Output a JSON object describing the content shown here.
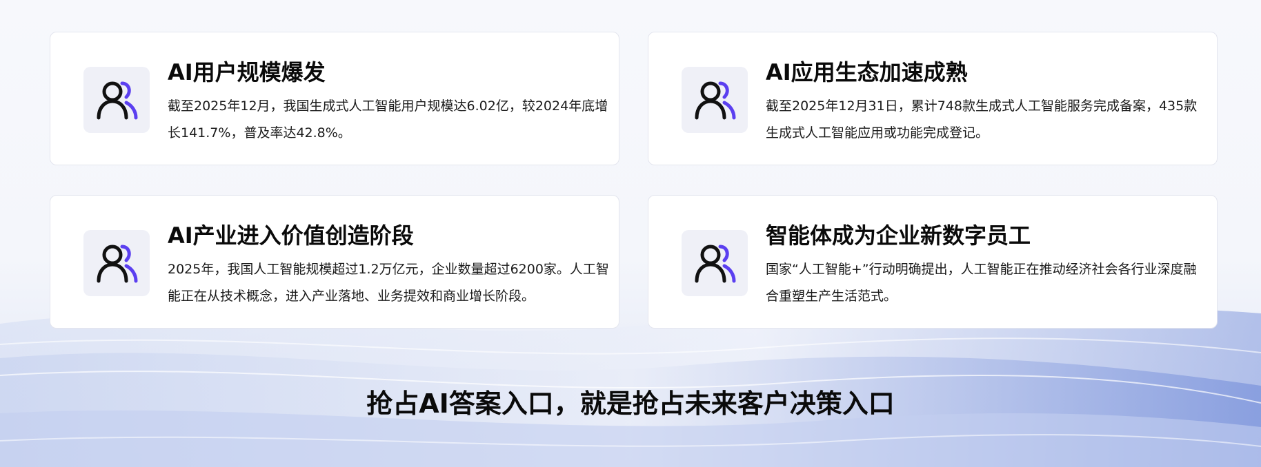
{
  "colors": {
    "page_background": "#f7f8fc",
    "card_background": "#ffffff",
    "card_border": "#e3e5ee",
    "icon_background": "#eff0f7",
    "icon_dark": "#111111",
    "icon_accent": "#5b3ff0",
    "wave_blue": "#6f8bd8"
  },
  "cards": [
    {
      "icon": "users-icon",
      "title": "AI用户规模爆发",
      "body": "截至2025年12月，我国生成式人工智能用户规模达6.02亿，较2024年底增长141.7%，普及率达42.8%。"
    },
    {
      "icon": "users-icon",
      "title": "AI应用生态加速成熟",
      "body": "截至2025年12月31日，累计748款生成式人工智能服务完成备案，435款生成式人工智能应用或功能完成登记。"
    },
    {
      "icon": "users-icon",
      "title": "AI产业进入价值创造阶段",
      "body": "2025年，我国人工智能规模超过1.2万亿元，企业数量超过6200家。人工智能正在从技术概念，进入产业落地、业务提效和商业增长阶段。"
    },
    {
      "icon": "users-icon",
      "title": "智能体成为企业新数字员工",
      "body": "国家“人工智能+”行动明确提出，人工智能正在推动经济社会各行业深度融合重塑生产生活范式。"
    }
  ],
  "footer": {
    "title": "抢占AI答案入口，就是抢占未来客户决策入口"
  }
}
